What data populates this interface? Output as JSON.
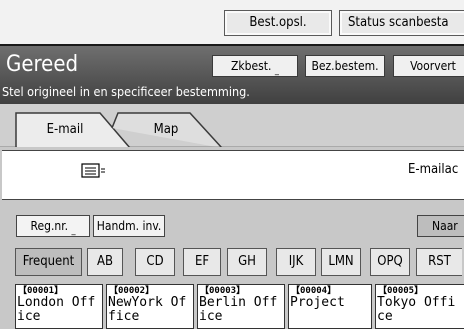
{
  "top_bar": {
    "best_opsl": "Best.opsl.",
    "status_scan": "Status scanbesta"
  },
  "header": {
    "title": "Gereed",
    "subtitle": "Stel origineel in en specificeer bestemming.",
    "btn_zkbest": "Zkbest.",
    "btn_bez": "Bez.bestem.",
    "btn_voorvert": "Voorvert"
  },
  "tabs": [
    {
      "label": "E-mail",
      "active": true
    },
    {
      "label": "Map",
      "active": false
    }
  ],
  "info": {
    "email_addr_label": "E-mailac",
    "icon": "email-send-icon"
  },
  "controls": {
    "regnr": "Reg.nr.",
    "handm": "Handm. inv.",
    "naar": "Naar"
  },
  "filter_tabs": [
    {
      "label": "Frequent",
      "active": true
    },
    {
      "label": "AB"
    },
    {
      "label": "CD"
    },
    {
      "label": "EF"
    },
    {
      "label": "GH"
    },
    {
      "label": "IJK"
    },
    {
      "label": "LMN"
    },
    {
      "label": "OPQ"
    },
    {
      "label": "RST"
    }
  ],
  "entries": [
    {
      "num": "【00001】",
      "name": "London Off ice"
    },
    {
      "num": "【00002】",
      "name": "NewYork Of fice"
    },
    {
      "num": "【00003】",
      "name": "Berlin Off ice"
    },
    {
      "num": "【00004】",
      "name": "Project"
    },
    {
      "num": "【00005】",
      "name": "Tokyo Offi ce"
    }
  ]
}
